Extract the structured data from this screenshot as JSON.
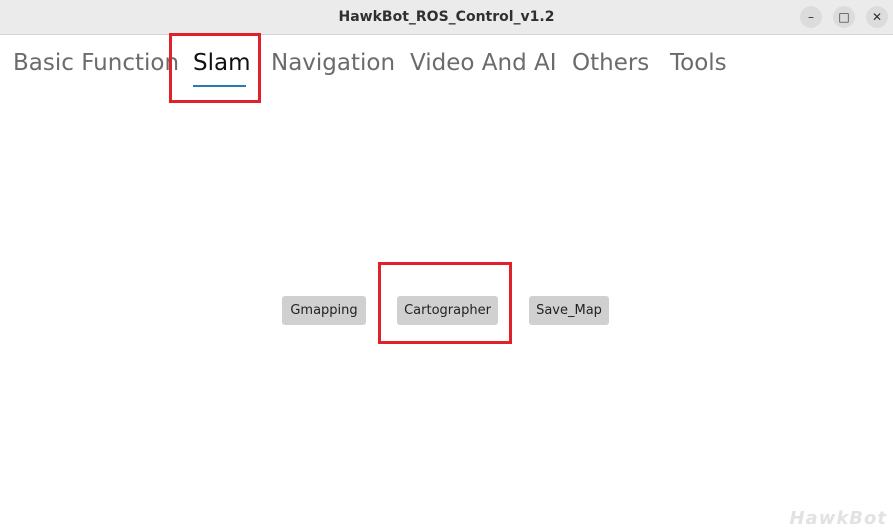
{
  "window": {
    "title": "HawkBot_ROS_Control_v1.2",
    "minimize_glyph": "–",
    "maximize_glyph": "□",
    "close_glyph": "✕"
  },
  "tabs": [
    {
      "label": "Basic Function"
    },
    {
      "label": "Slam"
    },
    {
      "label": "Navigation"
    },
    {
      "label": "Video And AI"
    },
    {
      "label": "Others"
    },
    {
      "label": "Tools"
    }
  ],
  "active_tab": "Slam",
  "buttons": {
    "gmapping": "Gmapping",
    "cartographer": "Cartographer",
    "save_map": "Save_Map"
  },
  "watermark": "HawkBot",
  "colors": {
    "highlight": "#e0202a",
    "tab_underline": "#2a79b5"
  }
}
